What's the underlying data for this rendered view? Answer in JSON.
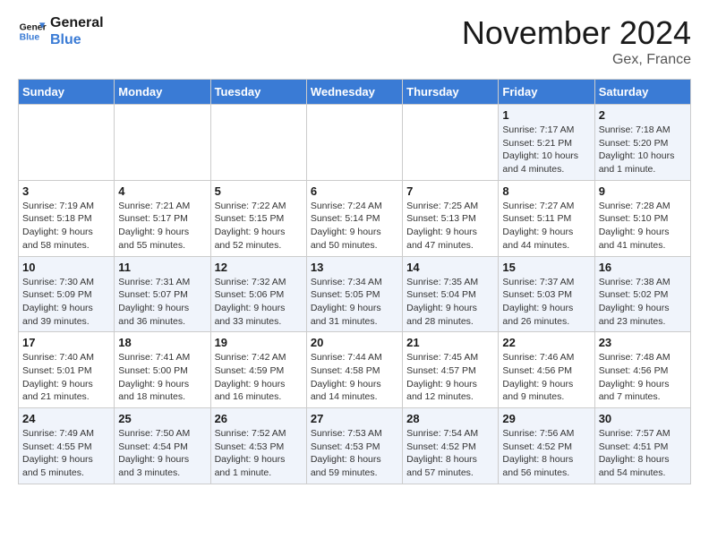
{
  "header": {
    "logo_line1": "General",
    "logo_line2": "Blue",
    "month": "November 2024",
    "location": "Gex, France"
  },
  "weekdays": [
    "Sunday",
    "Monday",
    "Tuesday",
    "Wednesday",
    "Thursday",
    "Friday",
    "Saturday"
  ],
  "weeks": [
    [
      {
        "day": "",
        "info": ""
      },
      {
        "day": "",
        "info": ""
      },
      {
        "day": "",
        "info": ""
      },
      {
        "day": "",
        "info": ""
      },
      {
        "day": "",
        "info": ""
      },
      {
        "day": "1",
        "info": "Sunrise: 7:17 AM\nSunset: 5:21 PM\nDaylight: 10 hours and 4 minutes."
      },
      {
        "day": "2",
        "info": "Sunrise: 7:18 AM\nSunset: 5:20 PM\nDaylight: 10 hours and 1 minute."
      }
    ],
    [
      {
        "day": "3",
        "info": "Sunrise: 7:19 AM\nSunset: 5:18 PM\nDaylight: 9 hours and 58 minutes."
      },
      {
        "day": "4",
        "info": "Sunrise: 7:21 AM\nSunset: 5:17 PM\nDaylight: 9 hours and 55 minutes."
      },
      {
        "day": "5",
        "info": "Sunrise: 7:22 AM\nSunset: 5:15 PM\nDaylight: 9 hours and 52 minutes."
      },
      {
        "day": "6",
        "info": "Sunrise: 7:24 AM\nSunset: 5:14 PM\nDaylight: 9 hours and 50 minutes."
      },
      {
        "day": "7",
        "info": "Sunrise: 7:25 AM\nSunset: 5:13 PM\nDaylight: 9 hours and 47 minutes."
      },
      {
        "day": "8",
        "info": "Sunrise: 7:27 AM\nSunset: 5:11 PM\nDaylight: 9 hours and 44 minutes."
      },
      {
        "day": "9",
        "info": "Sunrise: 7:28 AM\nSunset: 5:10 PM\nDaylight: 9 hours and 41 minutes."
      }
    ],
    [
      {
        "day": "10",
        "info": "Sunrise: 7:30 AM\nSunset: 5:09 PM\nDaylight: 9 hours and 39 minutes."
      },
      {
        "day": "11",
        "info": "Sunrise: 7:31 AM\nSunset: 5:07 PM\nDaylight: 9 hours and 36 minutes."
      },
      {
        "day": "12",
        "info": "Sunrise: 7:32 AM\nSunset: 5:06 PM\nDaylight: 9 hours and 33 minutes."
      },
      {
        "day": "13",
        "info": "Sunrise: 7:34 AM\nSunset: 5:05 PM\nDaylight: 9 hours and 31 minutes."
      },
      {
        "day": "14",
        "info": "Sunrise: 7:35 AM\nSunset: 5:04 PM\nDaylight: 9 hours and 28 minutes."
      },
      {
        "day": "15",
        "info": "Sunrise: 7:37 AM\nSunset: 5:03 PM\nDaylight: 9 hours and 26 minutes."
      },
      {
        "day": "16",
        "info": "Sunrise: 7:38 AM\nSunset: 5:02 PM\nDaylight: 9 hours and 23 minutes."
      }
    ],
    [
      {
        "day": "17",
        "info": "Sunrise: 7:40 AM\nSunset: 5:01 PM\nDaylight: 9 hours and 21 minutes."
      },
      {
        "day": "18",
        "info": "Sunrise: 7:41 AM\nSunset: 5:00 PM\nDaylight: 9 hours and 18 minutes."
      },
      {
        "day": "19",
        "info": "Sunrise: 7:42 AM\nSunset: 4:59 PM\nDaylight: 9 hours and 16 minutes."
      },
      {
        "day": "20",
        "info": "Sunrise: 7:44 AM\nSunset: 4:58 PM\nDaylight: 9 hours and 14 minutes."
      },
      {
        "day": "21",
        "info": "Sunrise: 7:45 AM\nSunset: 4:57 PM\nDaylight: 9 hours and 12 minutes."
      },
      {
        "day": "22",
        "info": "Sunrise: 7:46 AM\nSunset: 4:56 PM\nDaylight: 9 hours and 9 minutes."
      },
      {
        "day": "23",
        "info": "Sunrise: 7:48 AM\nSunset: 4:56 PM\nDaylight: 9 hours and 7 minutes."
      }
    ],
    [
      {
        "day": "24",
        "info": "Sunrise: 7:49 AM\nSunset: 4:55 PM\nDaylight: 9 hours and 5 minutes."
      },
      {
        "day": "25",
        "info": "Sunrise: 7:50 AM\nSunset: 4:54 PM\nDaylight: 9 hours and 3 minutes."
      },
      {
        "day": "26",
        "info": "Sunrise: 7:52 AM\nSunset: 4:53 PM\nDaylight: 9 hours and 1 minute."
      },
      {
        "day": "27",
        "info": "Sunrise: 7:53 AM\nSunset: 4:53 PM\nDaylight: 8 hours and 59 minutes."
      },
      {
        "day": "28",
        "info": "Sunrise: 7:54 AM\nSunset: 4:52 PM\nDaylight: 8 hours and 57 minutes."
      },
      {
        "day": "29",
        "info": "Sunrise: 7:56 AM\nSunset: 4:52 PM\nDaylight: 8 hours and 56 minutes."
      },
      {
        "day": "30",
        "info": "Sunrise: 7:57 AM\nSunset: 4:51 PM\nDaylight: 8 hours and 54 minutes."
      }
    ]
  ]
}
